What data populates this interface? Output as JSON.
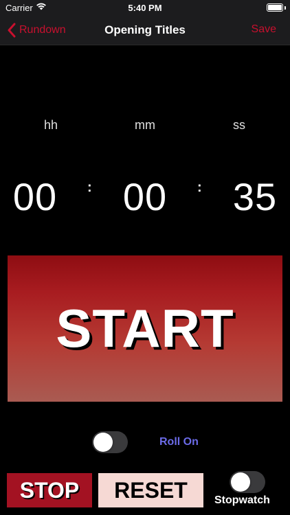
{
  "status_bar": {
    "carrier": "Carrier",
    "time": "5:40 PM",
    "battery_level": 1.0
  },
  "nav": {
    "back_label": "Rundown",
    "title": "Opening Titles",
    "save_label": "Save",
    "accent_color": "#c8102e"
  },
  "timer": {
    "hours_label": "hh",
    "minutes_label": "mm",
    "seconds_label": "ss",
    "hours": "00",
    "minutes": "00",
    "seconds": "35",
    "separator": ":"
  },
  "controls": {
    "start_label": "START",
    "roll_on_label": "Roll On",
    "roll_on_enabled": false,
    "stop_label": "STOP",
    "reset_label": "RESET",
    "stopwatch_label": "Stopwatch",
    "stopwatch_enabled": false
  },
  "icons": {
    "back": "chevron-left-icon",
    "wifi": "wifi-icon",
    "battery": "battery-icon"
  }
}
